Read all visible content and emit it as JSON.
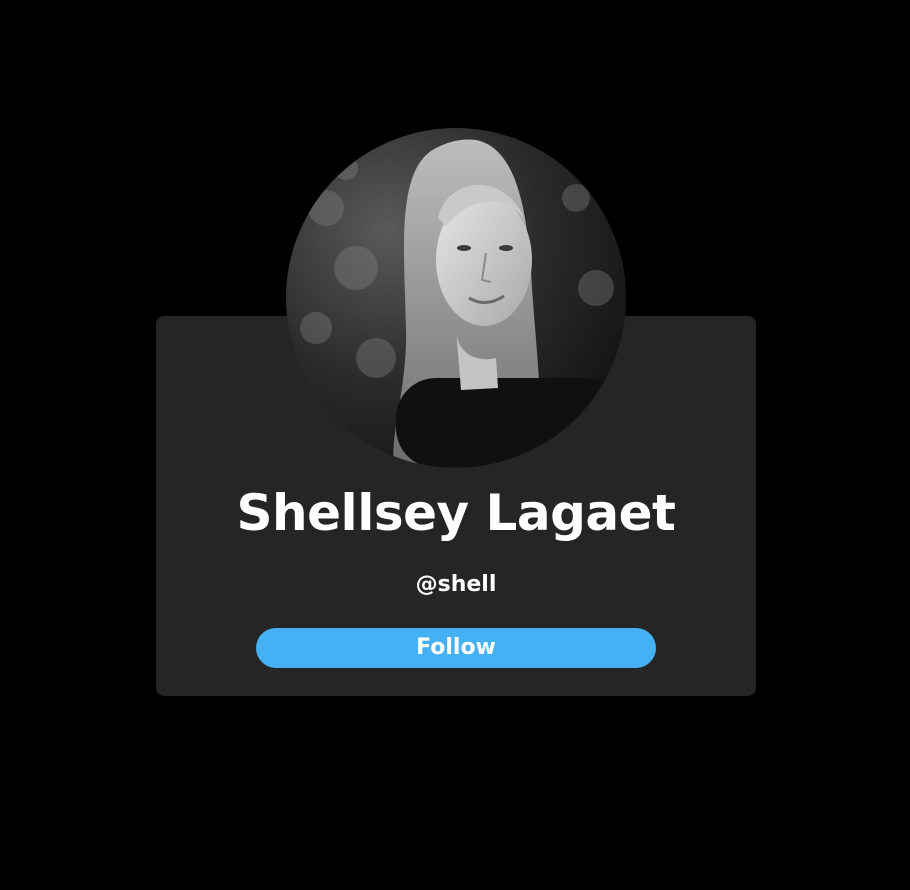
{
  "profile": {
    "name": "Shellsey Lagaet",
    "handle": "@shell",
    "avatar_alt": "profile-photo",
    "follow_label": "Follow"
  },
  "colors": {
    "background": "#000000",
    "card": "#252525",
    "accent": "#45b1f5",
    "text": "#ffffff"
  }
}
